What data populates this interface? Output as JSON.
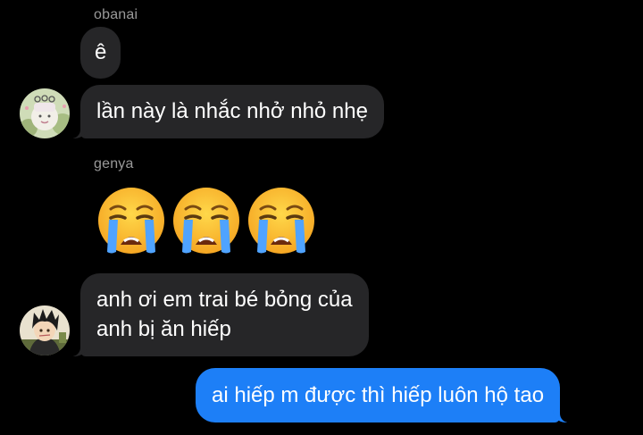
{
  "thread": {
    "group1": {
      "sender": "obanai",
      "messages": [
        "ê",
        "lần này là nhắc nhở nhỏ nhẹ"
      ]
    },
    "group2": {
      "sender": "genya",
      "emoji": [
        "crying-face-emoji",
        "crying-face-emoji",
        "crying-face-emoji"
      ],
      "message_line1": "anh ơi em trai bé bỏng của",
      "message_line2": "anh bị ăn hiếp"
    },
    "outgoing": {
      "message": "ai hiếp m được thì hiếp luôn hộ tao"
    }
  },
  "colors": {
    "background": "#000000",
    "incoming_bubble": "#262628",
    "outgoing_bubble": "#1d7ff7",
    "sender_name": "#9a9a9a"
  }
}
